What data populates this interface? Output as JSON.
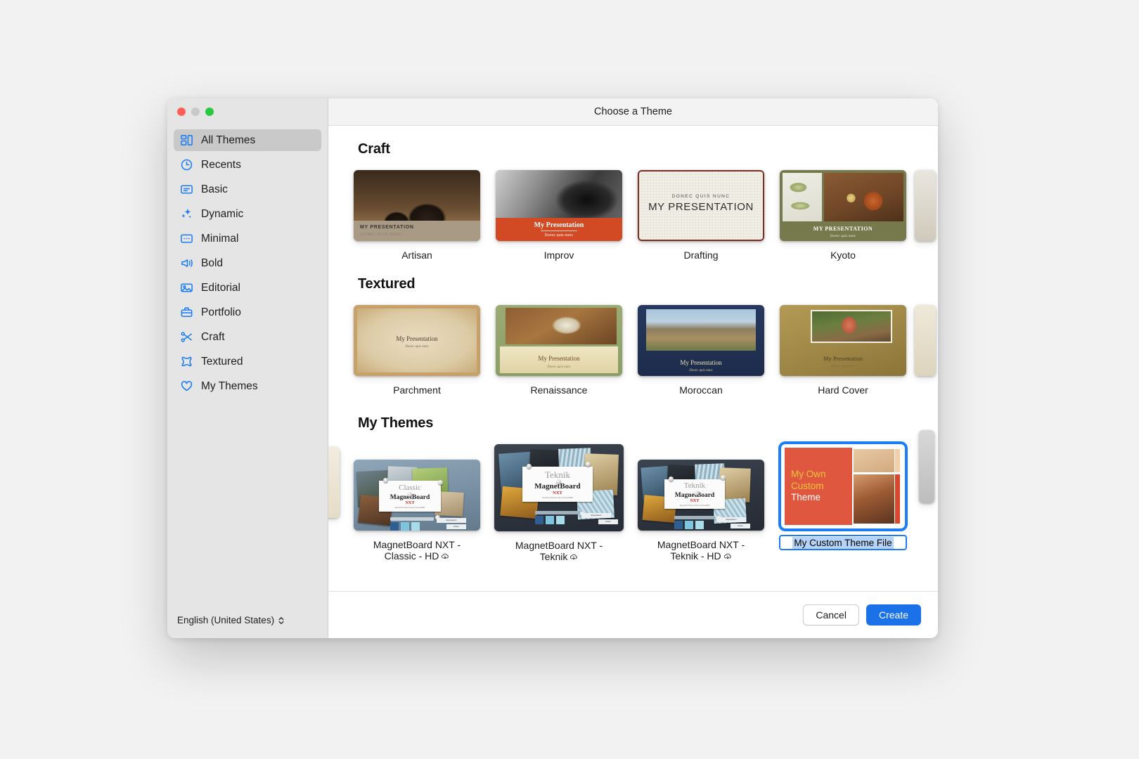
{
  "window": {
    "title": "Choose a Theme",
    "traffic_lights": [
      "close",
      "minimize",
      "zoom"
    ]
  },
  "sidebar": {
    "items": [
      {
        "label": "All Themes",
        "icon": "grid-icon",
        "selected": true
      },
      {
        "label": "Recents",
        "icon": "clock-icon",
        "selected": false
      },
      {
        "label": "Basic",
        "icon": "card-icon",
        "selected": false
      },
      {
        "label": "Dynamic",
        "icon": "sparkles-icon",
        "selected": false
      },
      {
        "label": "Minimal",
        "icon": "dots-card-icon",
        "selected": false
      },
      {
        "label": "Bold",
        "icon": "megaphone-icon",
        "selected": false
      },
      {
        "label": "Editorial",
        "icon": "photo-icon",
        "selected": false
      },
      {
        "label": "Portfolio",
        "icon": "briefcase-icon",
        "selected": false
      },
      {
        "label": "Craft",
        "icon": "scissors-icon",
        "selected": false
      },
      {
        "label": "Textured",
        "icon": "frame-icon",
        "selected": false
      },
      {
        "label": "My Themes",
        "icon": "heart-icon",
        "selected": false
      }
    ],
    "language": {
      "label": "English (United States)",
      "icon": "updown-chevron-icon"
    }
  },
  "sections": [
    {
      "title": "Craft",
      "themes": [
        {
          "name": "Artisan",
          "slide_title": "MY PRESENTATION",
          "slide_subtitle": "DONEC QUIS NUNC"
        },
        {
          "name": "Improv",
          "slide_title": "My Presentation",
          "slide_subtitle": "Donec quis nunc"
        },
        {
          "name": "Drafting",
          "slide_title": "MY PRESENTATION",
          "slide_subtitle": "DONEC QUIS NUNC"
        },
        {
          "name": "Kyoto",
          "slide_title": "MY PRESENTATION",
          "slide_subtitle": "Donec quis nunc"
        }
      ]
    },
    {
      "title": "Textured",
      "themes": [
        {
          "name": "Parchment",
          "slide_title": "My Presentation",
          "slide_subtitle": "Donec quis nunc"
        },
        {
          "name": "Renaissance",
          "slide_title": "My Presentation",
          "slide_subtitle": "Donec quis nunc"
        },
        {
          "name": "Moroccan",
          "slide_title": "My Presentation",
          "slide_subtitle": "Donec quis nunc"
        },
        {
          "name": "Hard Cover",
          "slide_title": "My Presentation",
          "slide_subtitle": "Donec quis nunc"
        }
      ]
    },
    {
      "title": "My Themes",
      "themes": [
        {
          "name": "MagnetBoard NXT - Classic - HD",
          "name_line1": "MagnetBoard NXT -",
          "name_line2": "Classic - HD",
          "badge": "cloud-download-icon",
          "art_title": "Classic",
          "art_brand": "MagnetBoard",
          "art_nxt": "NXT",
          "art_tagline": "Keynote 6 Theme Set by KeynoteBiz",
          "art_tab1": "Expression",
          "art_tab2": "Picks"
        },
        {
          "name": "MagnetBoard NXT - Teknik",
          "name_line1": "MagnetBoard NXT -",
          "name_line2": "Teknik",
          "badge": "cloud-download-icon",
          "art_title": "Teknik",
          "art_brand": "MagnetBoard",
          "art_nxt": "NXT",
          "art_tagline": "Keynote 6 Theme Set by KeynoteBiz",
          "art_tab1": "Expression",
          "art_tab2": "Picks"
        },
        {
          "name": "MagnetBoard NXT - Teknik - HD",
          "name_line1": "MagnetBoard NXT -",
          "name_line2": "Teknik - HD",
          "badge": "cloud-download-icon",
          "art_title": "Teknik",
          "art_brand": "MagnetBoard",
          "art_nxt": "NXT",
          "art_tagline": "Keynote 6 Theme Set by KeynoteBiz",
          "art_tab1": "Expression",
          "art_tab2": "Picks"
        },
        {
          "name": "My Custom Theme File",
          "selected": true,
          "editing": true,
          "art_line1": "My Own",
          "art_line2": "Custom",
          "art_line3": "Theme"
        }
      ]
    }
  ],
  "footer": {
    "cancel_label": "Cancel",
    "create_label": "Create"
  },
  "colors": {
    "accent": "#1b72e8",
    "selection_ring": "#1b7ef6",
    "text_selection": "#b4d3f7",
    "sidebar_bg": "#e5e5e5",
    "sidebar_active": "#c9c9c9",
    "icon_blue": "#1a7cf8"
  }
}
